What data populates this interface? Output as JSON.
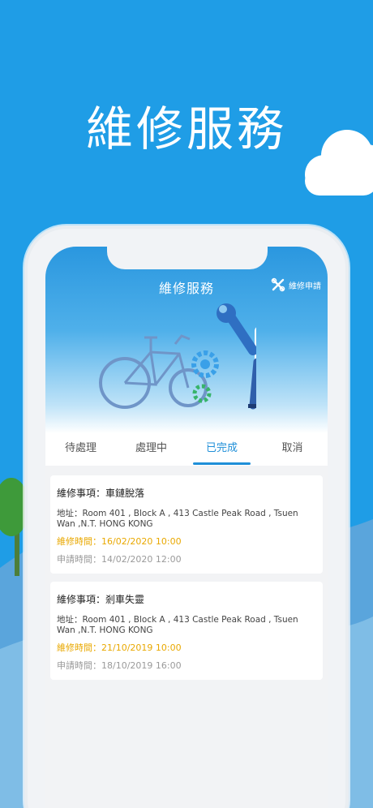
{
  "headline": "維修服務",
  "app": {
    "title": "維修服務",
    "apply_label": "維修申請",
    "apply_icon": "wrench-cross-icon"
  },
  "colors": {
    "background": "#1f9de6",
    "accent": "#1f8fd8",
    "repair_time": "#e9a800"
  },
  "tabs": [
    {
      "label": "待處理",
      "active": false
    },
    {
      "label": "處理中",
      "active": false
    },
    {
      "label": "已完成",
      "active": true
    },
    {
      "label": "取消",
      "active": false
    }
  ],
  "orders": [
    {
      "item": "維修事項：車鏈脫落",
      "address": "地址：Room 401 , Block A , 413 Castle Peak Road , Tsuen Wan ,N.T. HONG KONG",
      "repair_time": "維修時間：16/02/2020 10:00",
      "apply_time": "申請時間：14/02/2020 12:00"
    },
    {
      "item": "維修事項：剎車失靈",
      "address": "地址：Room 401 , Block A , 413 Castle Peak Road , Tsuen Wan ,N.T. HONG KONG",
      "repair_time": "維修時間：21/10/2019 10:00",
      "apply_time": "申請時間：18/10/2019 16:00"
    }
  ]
}
